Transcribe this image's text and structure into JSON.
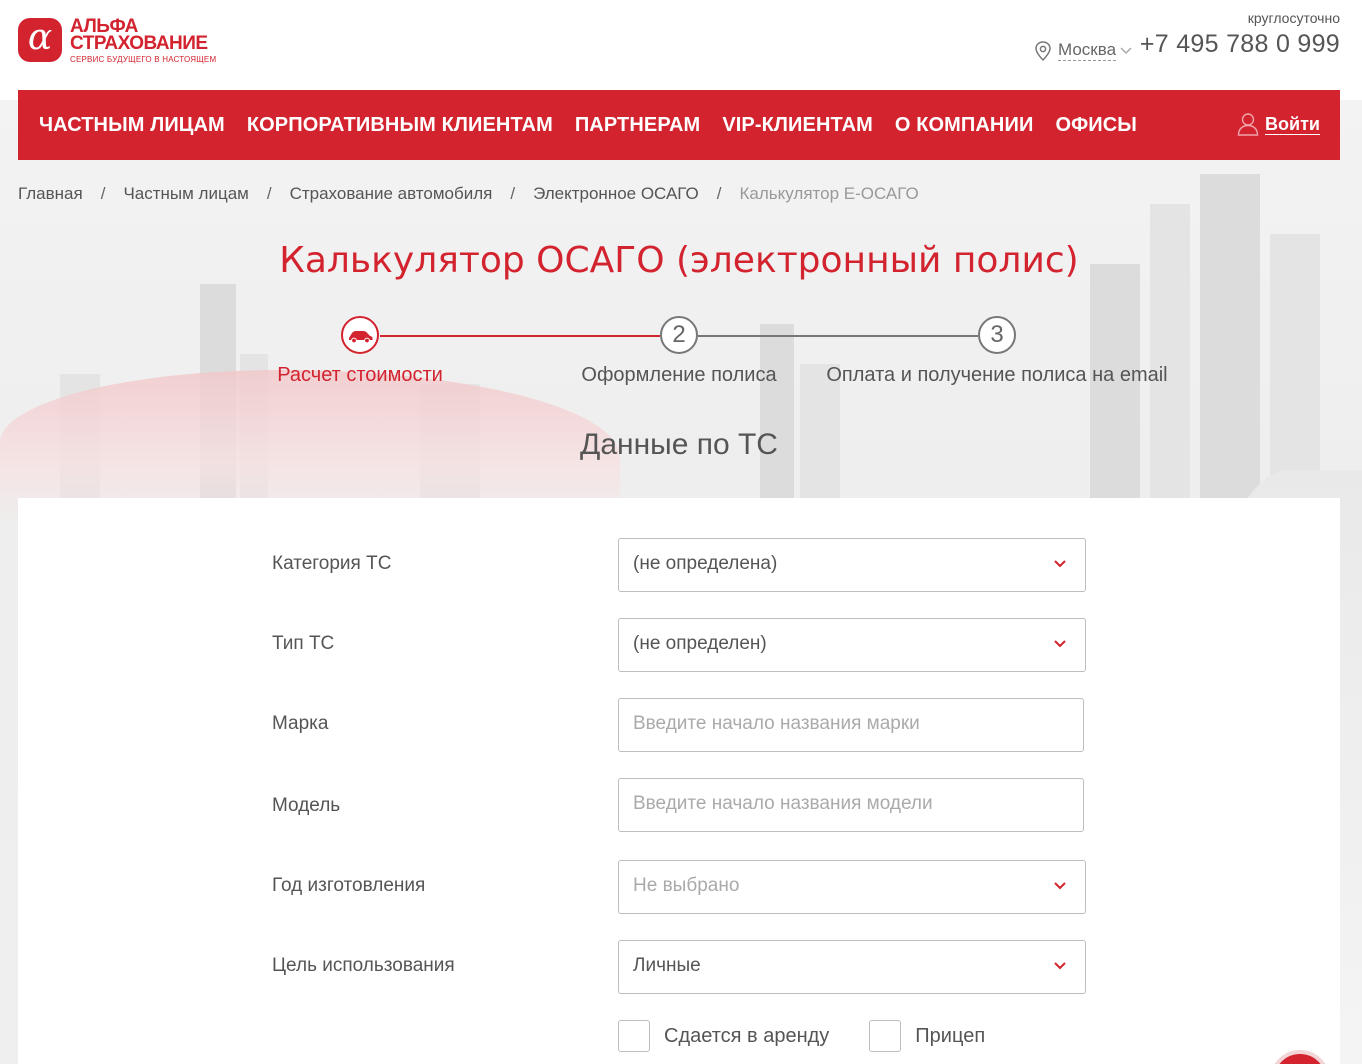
{
  "header": {
    "logo": {
      "mark": "α",
      "line1": "АЛЬФА",
      "line2": "СТРАХОВАНИЕ",
      "tagline": "СЕРВИС БУДУЩЕГО В НАСТОЯЩЕМ"
    },
    "city": "Москва",
    "hours": "круглосуточно",
    "phone": "+7 495 788 0 999"
  },
  "nav": {
    "items": [
      "ЧАСТНЫМ ЛИЦАМ",
      "КОРПОРАТИВНЫМ КЛИЕНТАМ",
      "ПАРТНЕРАМ",
      "VIP-КЛИЕНТАМ",
      "О КОМПАНИИ",
      "ОФИСЫ"
    ],
    "login": "Войти"
  },
  "breadcrumb": [
    "Главная",
    "Частным лицам",
    "Страхование автомобиля",
    "Электронное ОСАГО",
    "Калькулятор Е-ОСАГО"
  ],
  "page_title": "Калькулятор ОСАГО (электронный полис)",
  "stepper": {
    "steps": [
      {
        "number": "",
        "label": "Расчет стоимости",
        "active": true
      },
      {
        "number": "2",
        "label": "Оформление полиса",
        "active": false
      },
      {
        "number": "3",
        "label": "Оплата и получение полиса на email",
        "active": false
      }
    ]
  },
  "section_heading": "Данные по ТС",
  "form": {
    "category": {
      "label": "Категория ТС",
      "value": "(не определена)"
    },
    "type": {
      "label": "Тип ТС",
      "value": "(не определен)"
    },
    "brand": {
      "label": "Марка",
      "placeholder": "Введите начало названия марки"
    },
    "model": {
      "label": "Модель",
      "placeholder": "Введите начало названия модели"
    },
    "year": {
      "label": "Год изготовления",
      "value": "Не выбрано"
    },
    "purpose": {
      "label": "Цель использования",
      "value": "Личные"
    },
    "rented": {
      "label": "Сдается в аренду",
      "checked": false
    },
    "trailer": {
      "label": "Прицеп",
      "checked": false
    }
  },
  "colors": {
    "brand_red": "#d2232e",
    "text_gray": "#555555",
    "border_gray": "#bdbdbd"
  }
}
